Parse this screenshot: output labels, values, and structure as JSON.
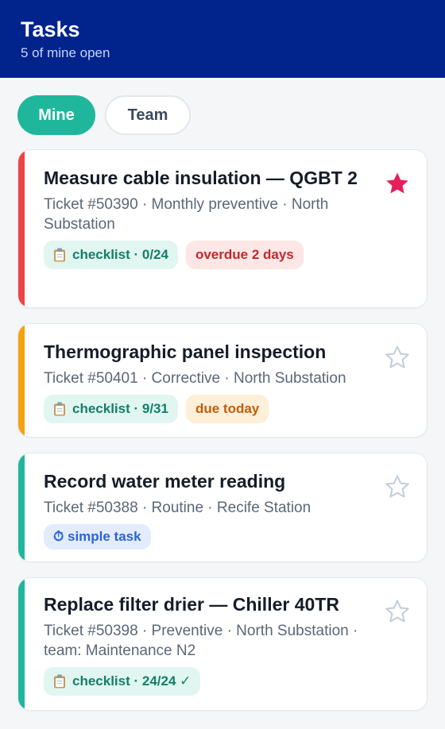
{
  "header": {
    "title": "Tasks",
    "subtitle": "5 of mine open"
  },
  "tabs": [
    {
      "label": "Mine",
      "active": true
    },
    {
      "label": "Team",
      "active": false
    }
  ],
  "colors": {
    "header_bg": "#00238c",
    "accent": "#1fb79b",
    "overdue": "#ee4444",
    "due_today": "#f4a20e",
    "normal": "#1fb79b",
    "star_filled": "#e51f5c",
    "star_empty": "#c3cdd8"
  },
  "tasks": [
    {
      "title": "Measure cable insulation — QGBT 2",
      "meta": "Ticket #50390 · Monthly preventive · North Substation",
      "chips": [
        {
          "kind": "checklist",
          "icon": "clipboard-icon",
          "text": "checklist · 0/24"
        },
        {
          "kind": "overdue",
          "text": "overdue 2 days"
        }
      ],
      "starred": true,
      "status_color": "overdue"
    },
    {
      "title": "Thermographic panel inspection",
      "meta": "Ticket #50401 · Corrective · North Substation",
      "chips": [
        {
          "kind": "checklist",
          "icon": "clipboard-icon",
          "text": "checklist · 9/31"
        },
        {
          "kind": "today",
          "text": "due today"
        }
      ],
      "starred": false,
      "status_color": "due_today"
    },
    {
      "title": "Record water meter reading",
      "meta": "Ticket #50388 · Routine · Recife Station",
      "chips": [
        {
          "kind": "simple",
          "icon": "clock-icon",
          "text": "⏱ simple task"
        }
      ],
      "starred": false,
      "status_color": "normal"
    },
    {
      "title": "Replace filter drier — Chiller 40TR",
      "meta": "Ticket #50398 · Preventive · North Substation · team: Maintenance N2",
      "chips": [
        {
          "kind": "checklist",
          "icon": "clipboard-icon",
          "text": "checklist · 24/24 ✓"
        }
      ],
      "starred": false,
      "status_color": "normal"
    }
  ]
}
